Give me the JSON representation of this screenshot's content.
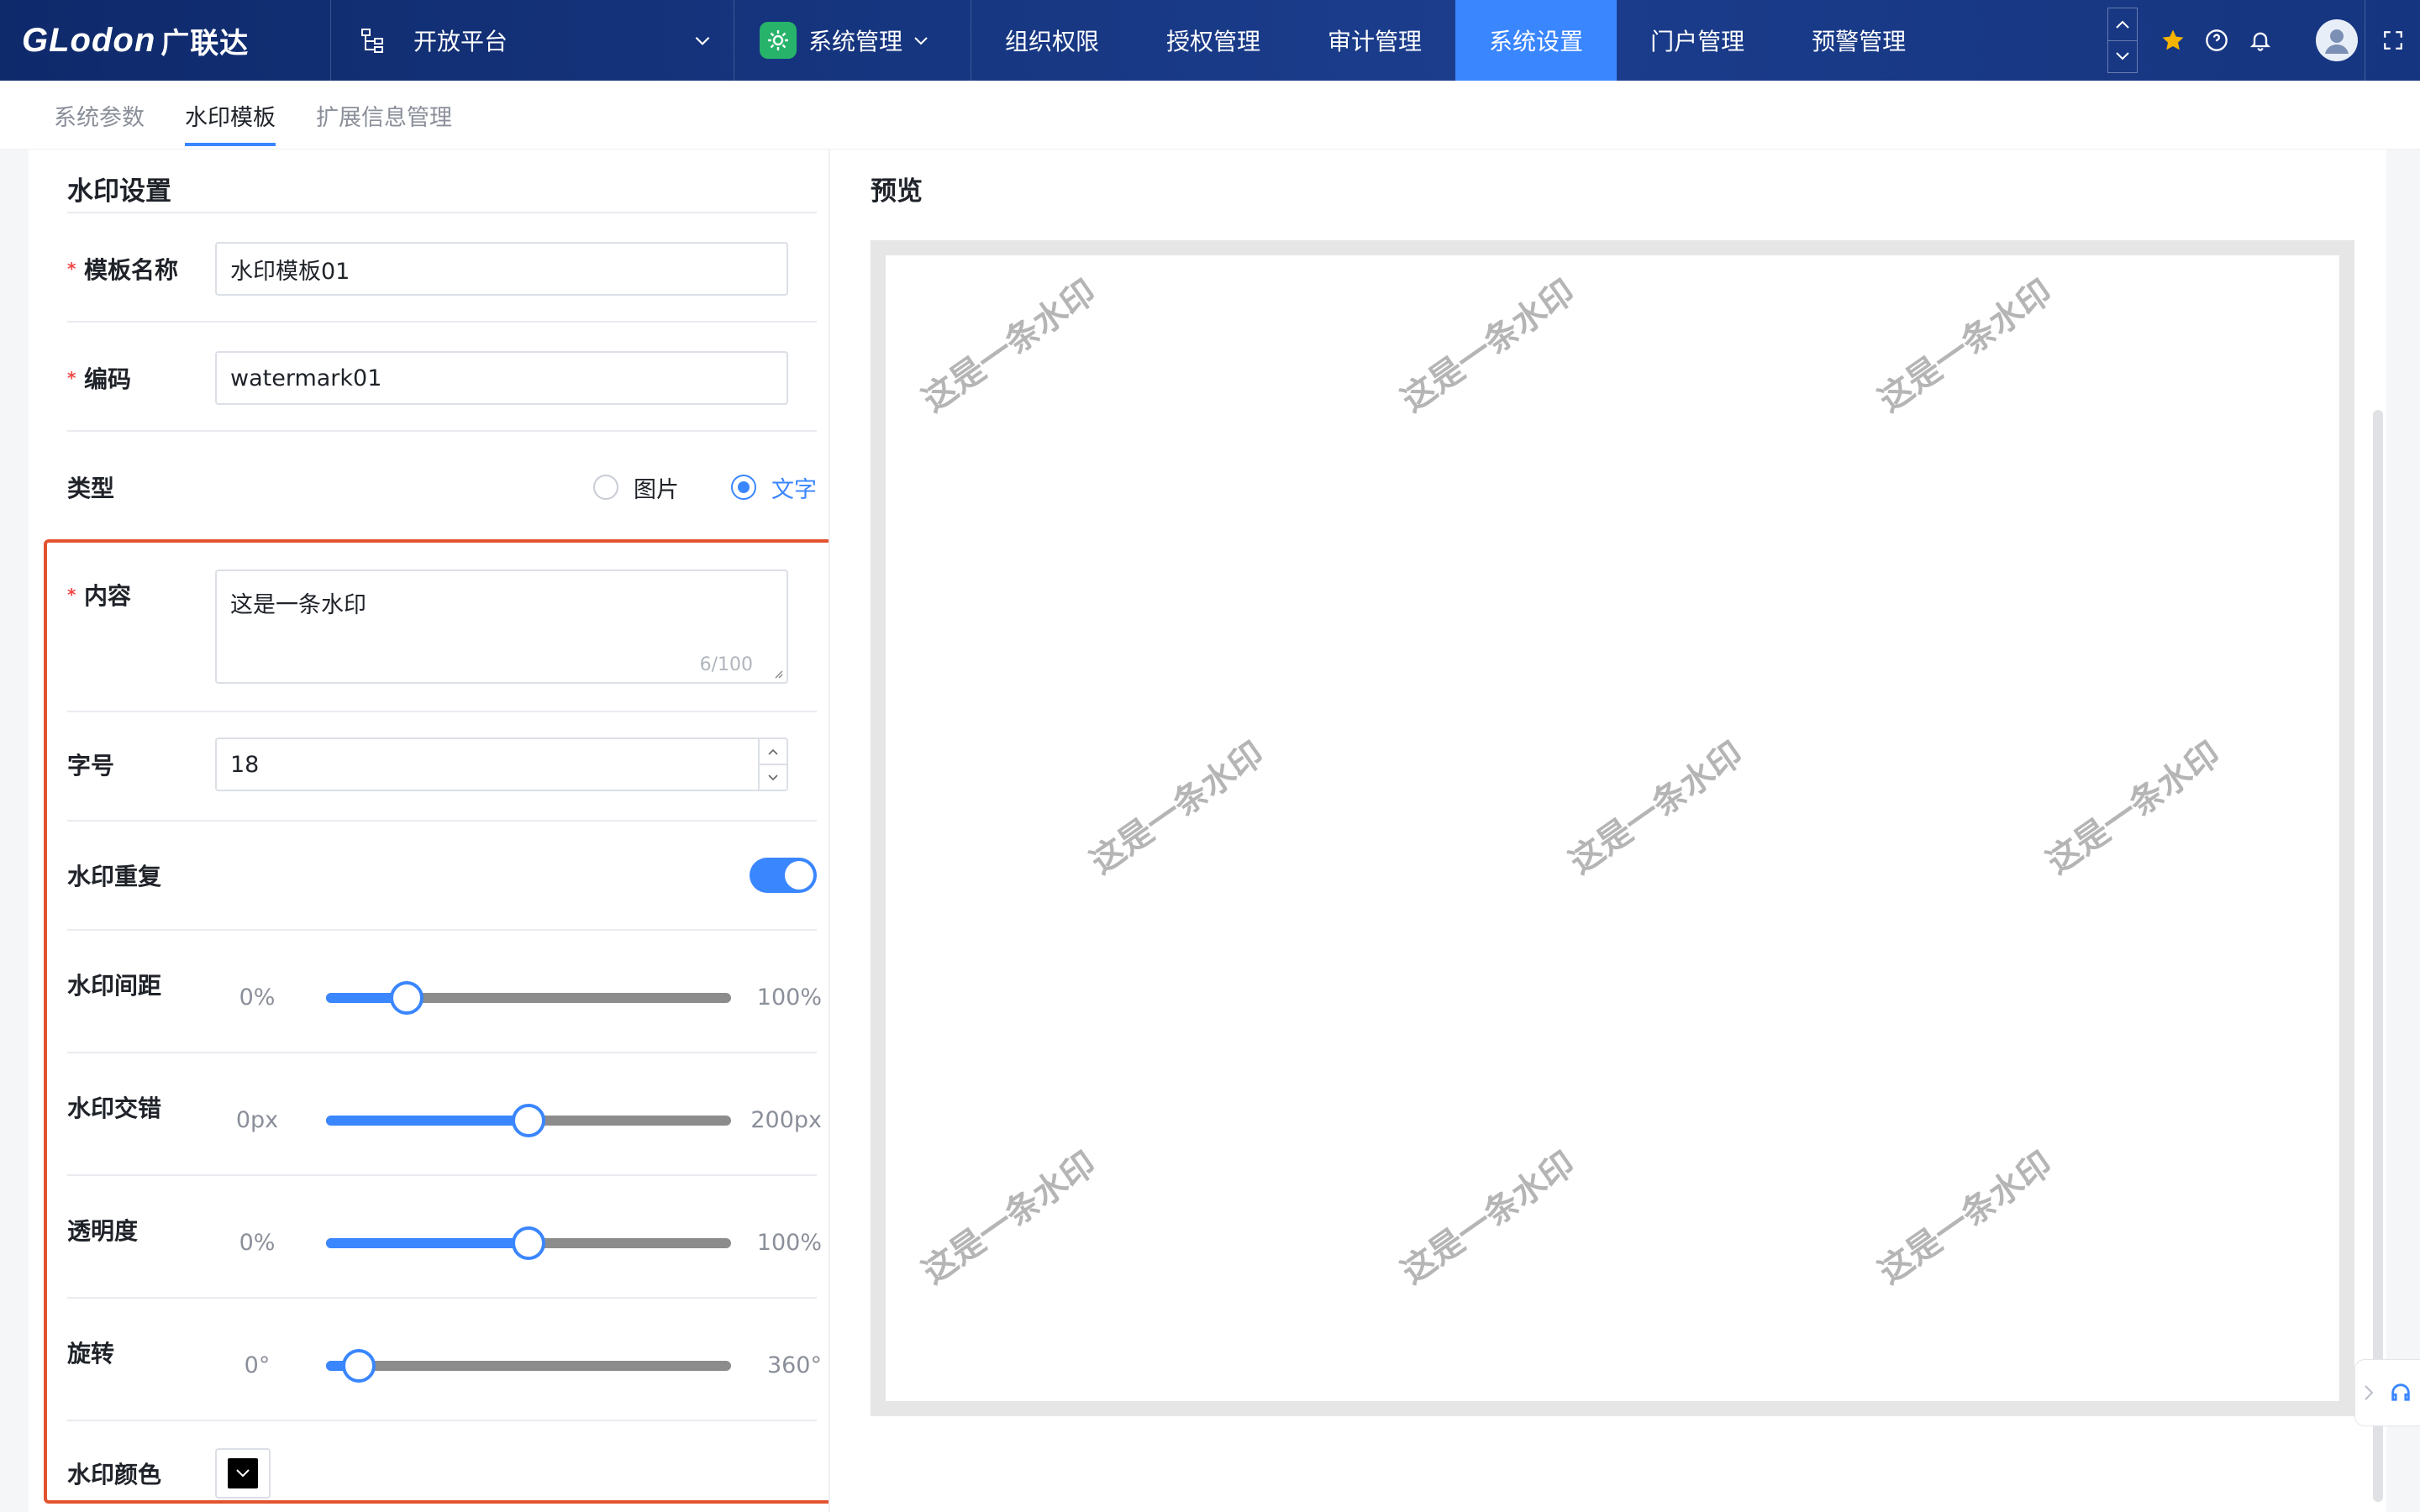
{
  "header": {
    "logo_text": "GLodon",
    "logo_cn": "广联达",
    "platform": "开放平台",
    "system_menu": "系统管理",
    "tabs": [
      {
        "label": "组织权限"
      },
      {
        "label": "授权管理"
      },
      {
        "label": "审计管理"
      },
      {
        "label": "系统设置",
        "active": true
      },
      {
        "label": "门户管理"
      },
      {
        "label": "预警管理"
      }
    ],
    "accent_color": "#3a86ff",
    "icons": [
      "star-icon",
      "help-icon",
      "bell-icon",
      "avatar",
      "fullscreen-icon"
    ]
  },
  "subtabs": [
    {
      "label": "系统参数"
    },
    {
      "label": "水印模板",
      "active": true
    },
    {
      "label": "扩展信息管理"
    }
  ],
  "form": {
    "section_title": "水印设置",
    "name_label": "模板名称",
    "name_value": "水印模板01",
    "code_label": "编码",
    "code_value": "watermark01",
    "type_label": "类型",
    "type_options": [
      "图片",
      "文字"
    ],
    "type_selected": "文字",
    "content_label": "内容",
    "content_value": "这是一条水印",
    "content_count": "6/100",
    "fontsize_label": "字号",
    "fontsize_value": "18",
    "repeat_label": "水印重复",
    "repeat_on": true,
    "spacing": {
      "label": "水印间距",
      "min": "0%",
      "max": "100%",
      "value_fraction": 0.2
    },
    "stagger": {
      "label": "水印交错",
      "min": "0px",
      "max": "200px",
      "value_fraction": 0.5
    },
    "opacity": {
      "label": "透明度",
      "min": "0%",
      "max": "100%",
      "value_fraction": 0.5
    },
    "rotation": {
      "label": "旋转",
      "min": "0°",
      "max": "360°",
      "value_fraction": 0.08
    },
    "color_label": "水印颜色",
    "color_value": "#000000"
  },
  "preview": {
    "title": "预览",
    "watermark_text": "这是一条水印"
  }
}
